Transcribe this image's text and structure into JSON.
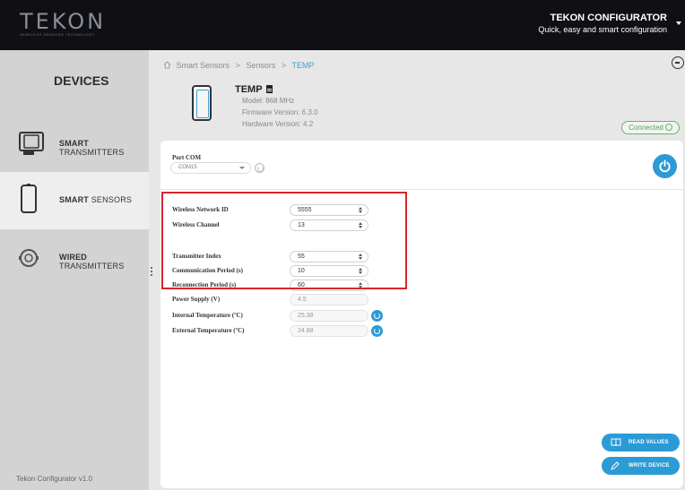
{
  "header": {
    "logo_text": "TEKON",
    "logo_tagline": "WIRELESS SENSORS TECHNOLOGY",
    "app_title": "TEKON CONFIGURATOR",
    "app_subtitle": "Quick, easy and smart configuration"
  },
  "sidebar": {
    "title": "DEVICES",
    "items": [
      {
        "bold": "SMART",
        "light": " TRANSMITTERS",
        "active": false
      },
      {
        "bold": "SMART",
        "light": " SENSORS",
        "active": true
      },
      {
        "bold": "WIRED",
        "light": " TRANSMITTERS",
        "active": false
      }
    ],
    "footer": "Tekon Configurator v1.0"
  },
  "breadcrumb": {
    "items": [
      "Smart Sensors",
      "Sensors",
      "TEMP"
    ]
  },
  "device": {
    "name": "TEMP",
    "model": "Model: 868 MHz",
    "firmware": "Firmware Version: 6.3.0",
    "hardware": "Hardware Version: 4.2",
    "status": "Connected"
  },
  "port": {
    "label": "Port COM",
    "value": "COM15"
  },
  "fields": [
    {
      "label": "Wireless Network ID",
      "value": "5555"
    },
    {
      "label": "Wireless Channel",
      "value": "13"
    },
    {
      "label": "Transmitter Index",
      "value": "55"
    },
    {
      "label": "Communication Period (s)",
      "value": "10"
    },
    {
      "label": "Reconnection Period (s)",
      "value": "60"
    },
    {
      "label": "Power Supply (V)",
      "value": "4.5"
    },
    {
      "label": "Internal Temperature (ºC)",
      "value": "25.38"
    },
    {
      "label": "External Temperature (ºC)",
      "value": "24.88"
    }
  ],
  "actions": {
    "read_values": "READ VALUES",
    "write_device": "WRITE DEVICE"
  },
  "colors": {
    "accent": "#2b9bd6",
    "highlight_border": "#d9252b",
    "connected": "#5cb85c",
    "topbar": "#0f0f14"
  }
}
